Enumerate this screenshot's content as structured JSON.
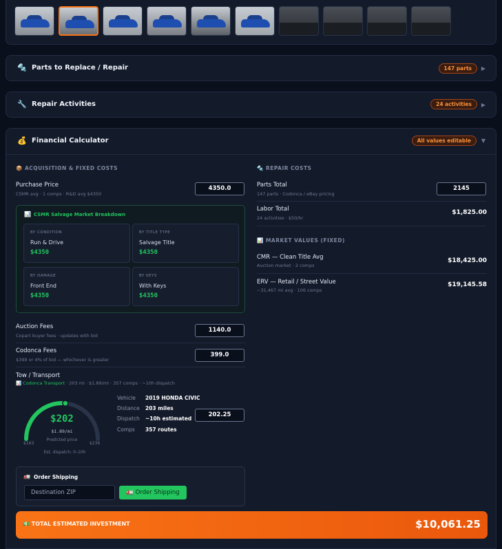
{
  "gallery": {
    "thumbnails": [
      {
        "name": "car-photo-1",
        "kind": "exterior"
      },
      {
        "name": "car-photo-2",
        "kind": "exterior"
      },
      {
        "name": "car-photo-3",
        "kind": "exterior"
      },
      {
        "name": "car-photo-4",
        "kind": "exterior"
      },
      {
        "name": "car-photo-5",
        "kind": "exterior"
      },
      {
        "name": "car-photo-6",
        "kind": "exterior"
      },
      {
        "name": "car-photo-7",
        "kind": "interior"
      },
      {
        "name": "car-photo-8",
        "kind": "interior"
      },
      {
        "name": "car-photo-9",
        "kind": "interior"
      },
      {
        "name": "car-photo-10",
        "kind": "interior"
      }
    ],
    "active_index": 1
  },
  "sections": {
    "parts": {
      "icon": "gear-icon",
      "title": "Parts to Replace / Repair",
      "badge": "147 parts",
      "arrow": "▶"
    },
    "repair": {
      "icon": "wrench-icon",
      "title": "Repair Activities",
      "badge": "24 activities",
      "arrow": "▶"
    },
    "financial": {
      "icon": "money-bag-icon",
      "title": "Financial Calculator",
      "badge": "All values editable",
      "arrow": "▼"
    }
  },
  "acquisition": {
    "heading": "ACQUISITION & FIXED COSTS",
    "purchase": {
      "label": "Purchase Price",
      "sub": "CSMR avg · 1 comps · R&D avg $4350",
      "value": "4350.0"
    },
    "csmr": {
      "title": "CSMR Salvage Market Breakdown",
      "cells": [
        {
          "key": "BY CONDITION",
          "name": "Run & Drive",
          "price": "$4350"
        },
        {
          "key": "BY TITLE TYPE",
          "name": "Salvage Title",
          "price": "$4350"
        },
        {
          "key": "BY DAMAGE",
          "name": "Front End",
          "price": "$4350"
        },
        {
          "key": "BY KEYS",
          "name": "With Keys",
          "price": "$4350"
        }
      ]
    },
    "auction": {
      "label": "Auction Fees",
      "sub": "Copart buyer fees · updates with bid",
      "value": "1140.0"
    },
    "codonca": {
      "label": "Codonca Fees",
      "sub": "$399 or 4% of bid — whichever is greater",
      "value": "399.0"
    },
    "tow": {
      "label": "Tow / Transport",
      "provider": "Codonca Transport",
      "meta": " · 203 mi · $1.89/mi · 357 comps · ~10h dispatch",
      "value": "202.25",
      "gauge": {
        "price": "$202",
        "rate": "$1.89/mi",
        "caption": "Predicted price",
        "min": "$163",
        "max": "$236",
        "est": "Est. dispatch: 0–10h",
        "fraction": 0.53
      },
      "details": [
        {
          "k": "Vehicle",
          "v": "2019 HONDA CIVIC"
        },
        {
          "k": "Distance",
          "v": "203 miles"
        },
        {
          "k": "Dispatch",
          "v": "~10h estimated"
        },
        {
          "k": "Comps",
          "v": "357 routes"
        }
      ]
    },
    "shipping": {
      "title": "Order Shipping",
      "zip_placeholder": "Destination ZIP",
      "button": "Order Shipping"
    }
  },
  "repair_costs": {
    "heading": "REPAIR COSTS",
    "parts_total": {
      "label": "Parts Total",
      "sub": "147 parts · Codonca / eBay pricing",
      "value": "2145"
    },
    "labor_total": {
      "label": "Labor Total",
      "sub": "24 activities · $50/hr",
      "value": "$1,825.00"
    }
  },
  "market": {
    "heading": "MARKET VALUES (FIXED)",
    "cmr": {
      "label": "CMR — Clean Title Avg",
      "sub": "Auction market · 2 comps",
      "value": "$18,425.00"
    },
    "erv": {
      "label": "ERV — Retail / Street Value",
      "sub": "~31,467 mi avg · 106 comps",
      "value": "$19,145.58"
    }
  },
  "total": {
    "label": "TOTAL ESTIMATED INVESTMENT",
    "value": "$10,061.25"
  },
  "colors": {
    "accent": "#f97316",
    "success": "#22c55e",
    "panel": "#131a2a",
    "background": "#0a0f1c"
  }
}
